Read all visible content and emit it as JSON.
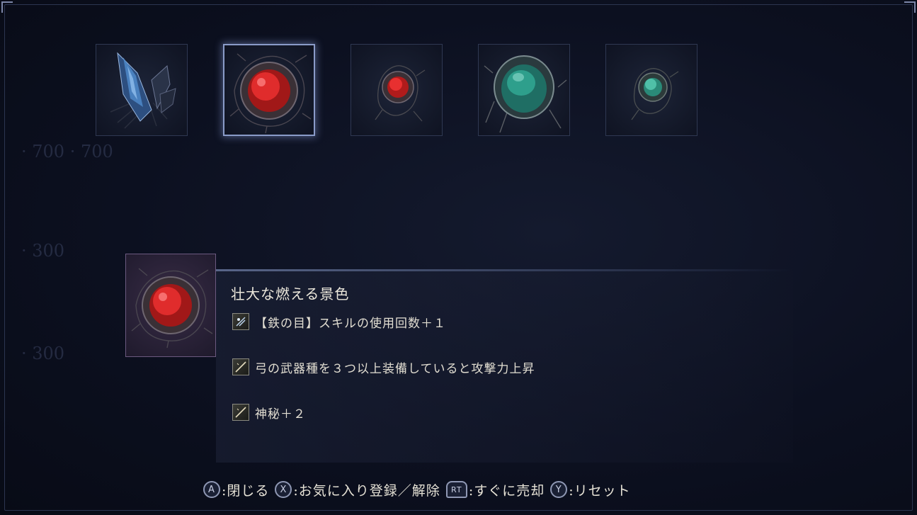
{
  "slots": [
    {
      "name": "blue-crystal-relic",
      "color": "#4f88c9",
      "selected": false
    },
    {
      "name": "large-red-relic",
      "color": "#d42a2a",
      "selected": true
    },
    {
      "name": "small-red-relic",
      "color": "#d42a2a",
      "selected": false
    },
    {
      "name": "large-green-relic",
      "color": "#2e9f8c",
      "selected": false
    },
    {
      "name": "small-green-relic",
      "color": "#3fb79d",
      "selected": false
    }
  ],
  "detail": {
    "title": "壮大な燃える景色",
    "icon": "large-red-relic",
    "effects": [
      {
        "icon": "skill-effect-icon",
        "text": "【鉄の目】スキルの使用回数＋１"
      },
      {
        "icon": "weapon-effect-icon",
        "text": "弓の武器種を３つ以上装備していると攻撃力上昇"
      },
      {
        "icon": "weapon-effect-icon",
        "text": "神秘＋２"
      }
    ]
  },
  "controls": [
    {
      "button": "A",
      "label": ":閉じる"
    },
    {
      "button": "X",
      "label": ":お気に入り登録／解除"
    },
    {
      "button": "RT",
      "label": ":すぐに売却"
    },
    {
      "button": "Y",
      "label": ":リセット"
    }
  ],
  "colors": {
    "accent": "#8a9bc8",
    "relic_red": "#d42a2a",
    "relic_green": "#2e9f8c",
    "relic_blue": "#4f88c9"
  }
}
